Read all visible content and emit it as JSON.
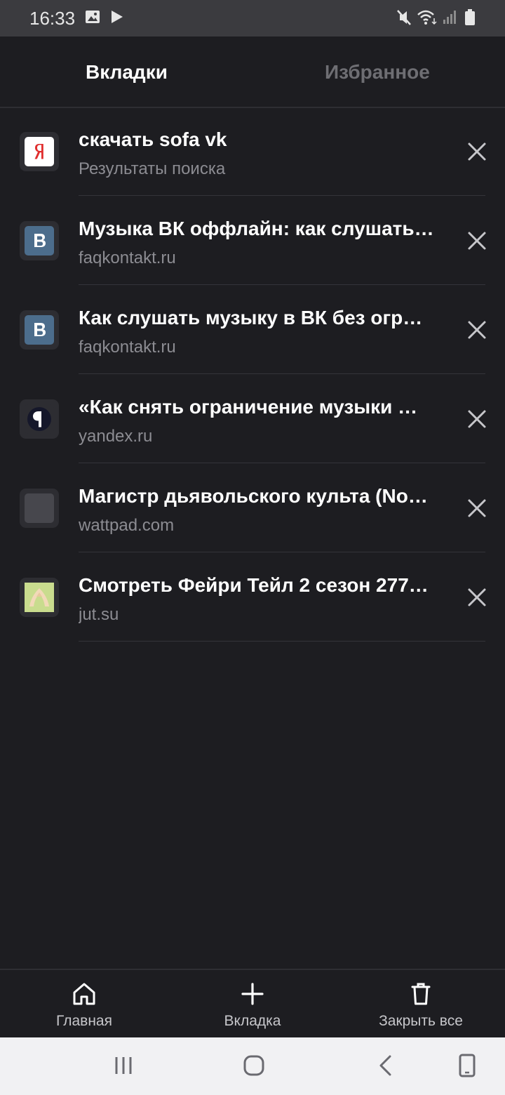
{
  "status_bar": {
    "time": "16:33",
    "icons": [
      "image-icon",
      "play-icon",
      "mute-icon",
      "wifi-icon",
      "signal-icon",
      "battery-icon"
    ]
  },
  "header": {
    "tabs": [
      {
        "label": "Вкладки",
        "active": true
      },
      {
        "label": "Избранное",
        "active": false
      }
    ]
  },
  "tab_list": [
    {
      "title": "скачать sofa vk",
      "url": "Результаты поиска",
      "favicon": "yandex-favicon"
    },
    {
      "title": "Музыка ВК оффлайн: как слушать…",
      "url": "faqkontakt.ru",
      "favicon": "vk-favicon"
    },
    {
      "title": "Как слушать музыку в ВК без огр…",
      "url": "faqkontakt.ru",
      "favicon": "vk-favicon"
    },
    {
      "title": "«Как снять ограничение музыки …",
      "url": "yandex.ru",
      "favicon": "yandex-zen-favicon"
    },
    {
      "title": "Магистр дьявольского культа (No…",
      "url": "wattpad.com",
      "favicon": "blank-favicon"
    },
    {
      "title": "Смотреть Фейри Тейл 2 сезон 277…",
      "url": "jut.su",
      "favicon": "jutsu-favicon"
    }
  ],
  "toolbar": {
    "home_label": "Главная",
    "new_tab_label": "Вкладка",
    "close_all_label": "Закрыть все"
  },
  "navbar": {
    "icons": [
      "recent-apps-icon",
      "home-icon",
      "back-icon",
      "screen-rotate-icon"
    ]
  },
  "colors": {
    "background": "#1d1d21",
    "status_bar": "#3b3b3f",
    "inactive_tab": "#6e6e73",
    "subtitle": "#8c8c92"
  }
}
